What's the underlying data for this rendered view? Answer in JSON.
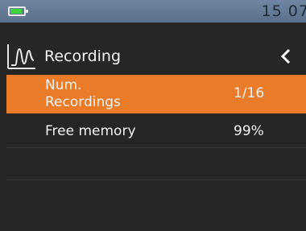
{
  "status_bar": {
    "time": "15 07",
    "battery_icon": "battery-icon"
  },
  "header": {
    "icon": "waveform-icon",
    "title": "Recording",
    "back_icon": "chevron-left-icon"
  },
  "menu": [
    {
      "label": "Num.\nRecordings",
      "value": "1/16",
      "selected": true
    },
    {
      "label": "Free memory",
      "value": "99%",
      "selected": false
    }
  ],
  "colors": {
    "status_bar": "#6a819d",
    "battery_fill": "#3ed43a",
    "background": "#272625",
    "selected_row": "#ea7b28",
    "text": "#f4f4f4"
  }
}
